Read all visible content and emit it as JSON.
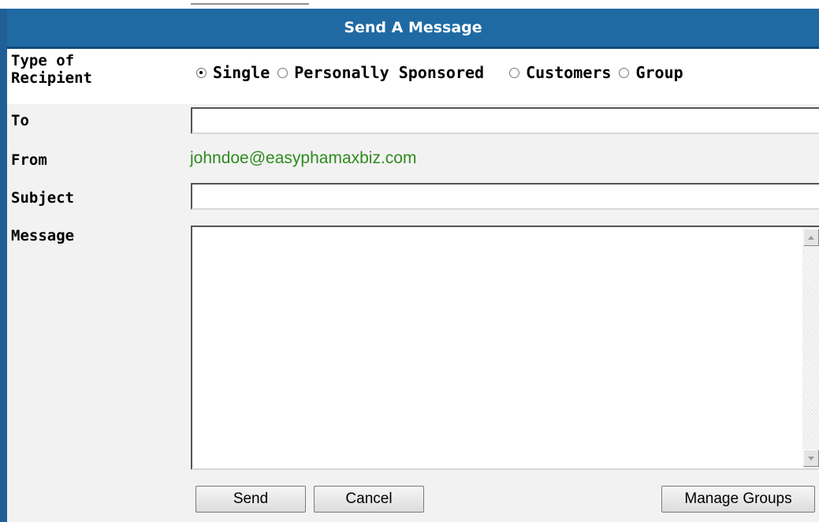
{
  "form": {
    "title": "Send A Message",
    "type_of_recipient": {
      "label": "Type of\nRecipient",
      "options": [
        {
          "label": "Single",
          "checked": true
        },
        {
          "label": "Personally Sponsored",
          "checked": false
        },
        {
          "label": "Customers",
          "checked": false
        },
        {
          "label": "Group",
          "checked": false
        }
      ]
    },
    "to": {
      "label": "To",
      "value": ""
    },
    "from": {
      "label": "From",
      "value": "johndoe@easyphamaxbiz.com"
    },
    "subject": {
      "label": "Subject",
      "value": ""
    },
    "message": {
      "label": "Message",
      "value": ""
    },
    "buttons": {
      "send": "Send",
      "cancel": "Cancel",
      "manage_groups": "Manage Groups"
    }
  },
  "colors": {
    "header_blue": "#1f6aa3",
    "from_green": "#2e8b1e",
    "row_gray": "#f2f2f2"
  }
}
